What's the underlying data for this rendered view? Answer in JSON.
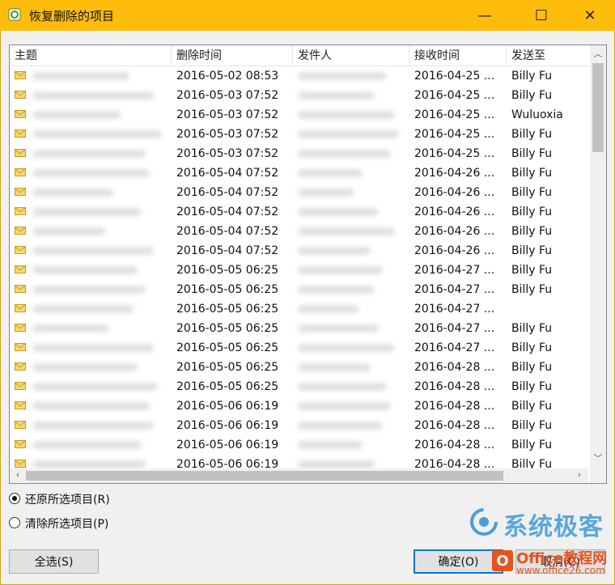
{
  "window": {
    "title": "恢复删除的项目",
    "minimize": "—",
    "maximize": "☐",
    "close": "✕"
  },
  "columns": [
    "主题",
    "删除时间",
    "发件人",
    "接收时间",
    "发送至"
  ],
  "rows": [
    {
      "deleted": "2016-05-02 08:53",
      "received": "2016-04-25 ...",
      "to": "Billy Fu"
    },
    {
      "deleted": "2016-05-03 07:52",
      "received": "2016-04-25 ...",
      "to": "Billy Fu"
    },
    {
      "deleted": "2016-05-03 07:52",
      "received": "2016-04-25 ...",
      "to": "Wuluoxia"
    },
    {
      "deleted": "2016-05-03 07:52",
      "received": "2016-04-25 ...",
      "to": "Billy Fu"
    },
    {
      "deleted": "2016-05-03 07:52",
      "received": "2016-04-25 ...",
      "to": "Billy Fu"
    },
    {
      "deleted": "2016-05-04 07:52",
      "received": "2016-04-26 ...",
      "to": "Billy Fu"
    },
    {
      "deleted": "2016-05-04 07:52",
      "received": "2016-04-26 ...",
      "to": "Billy Fu"
    },
    {
      "deleted": "2016-05-04 07:52",
      "received": "2016-04-26 ...",
      "to": "Billy Fu"
    },
    {
      "deleted": "2016-05-04 07:52",
      "received": "2016-04-26 ...",
      "to": "Billy Fu"
    },
    {
      "deleted": "2016-05-04 07:52",
      "received": "2016-04-26 ...",
      "to": "Billy Fu"
    },
    {
      "deleted": "2016-05-05 06:25",
      "received": "2016-04-27 ...",
      "to": "Billy Fu"
    },
    {
      "deleted": "2016-05-05 06:25",
      "received": "2016-04-27 ...",
      "to": "Billy Fu"
    },
    {
      "deleted": "2016-05-05 06:25",
      "received": "2016-04-27 ...",
      "to": ""
    },
    {
      "deleted": "2016-05-05 06:25",
      "received": "2016-04-27 ...",
      "to": "Billy Fu"
    },
    {
      "deleted": "2016-05-05 06:25",
      "received": "2016-04-27 ...",
      "to": "Billy Fu"
    },
    {
      "deleted": "2016-05-05 06:25",
      "received": "2016-04-28 ...",
      "to": "Billy Fu"
    },
    {
      "deleted": "2016-05-05 06:25",
      "received": "2016-04-28 ...",
      "to": "Billy Fu"
    },
    {
      "deleted": "2016-05-06 06:19",
      "received": "2016-04-28 ...",
      "to": "Billy Fu"
    },
    {
      "deleted": "2016-05-06 06:19",
      "received": "2016-04-28 ...",
      "to": "Billy Fu"
    },
    {
      "deleted": "2016-05-06 06:19",
      "received": "2016-04-28 ...",
      "to": "Billy Fu"
    },
    {
      "deleted": "2016-05-06 06:19",
      "received": "2016-04-28 ...",
      "to": "Billy Fu"
    }
  ],
  "options": {
    "restore": "还原所选项目(R)",
    "purge": "清除所选项目(P)",
    "selected": "restore"
  },
  "buttons": {
    "select_all": "全选(S)",
    "ok": "确定(O)",
    "cancel": "取消(C)"
  },
  "watermark": {
    "brand1": "系统极客",
    "brand2_title": "Office教程网",
    "brand2_url": "www.office26.com",
    "brand2_icon": "O"
  },
  "colors": {
    "titlebar": "#ffbd0b",
    "accent": "#0078d7",
    "envelope": "#f2c94c"
  }
}
